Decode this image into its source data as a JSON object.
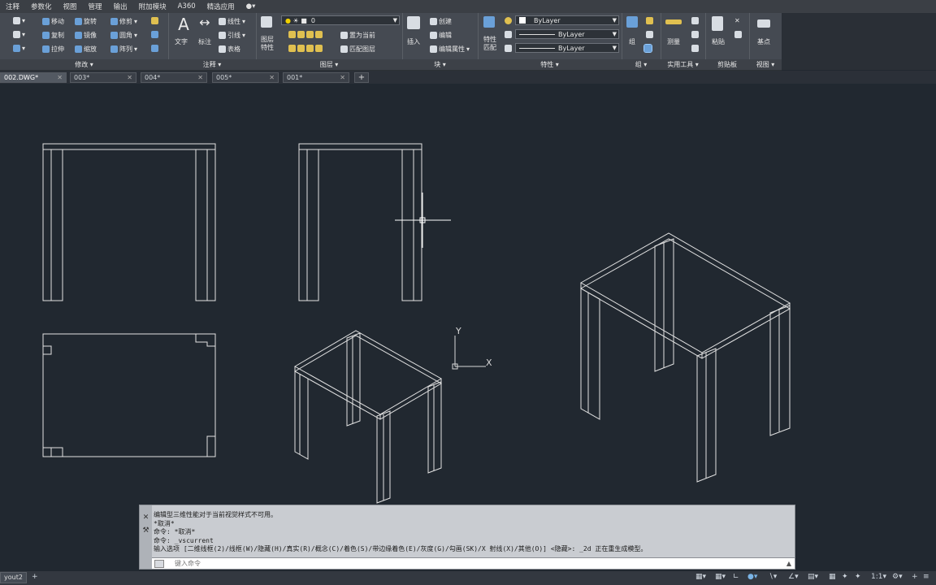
{
  "menubar": {
    "items": [
      "注释",
      "参数化",
      "视图",
      "管理",
      "输出",
      "附加模块",
      "A360",
      "精选应用"
    ]
  },
  "ribbon": {
    "modify": {
      "title": "修改",
      "items": [
        "移动",
        "旋转",
        "修剪",
        "复制",
        "镜像",
        "圆角",
        "拉伸",
        "缩放",
        "阵列"
      ]
    },
    "annotation": {
      "title": "注释",
      "text_label": "文字",
      "dim_label": "标注",
      "items": [
        "线性",
        "引线",
        "表格"
      ]
    },
    "layers": {
      "title": "图层",
      "props_label": "图层\n特性",
      "layer_value": "0",
      "items": [
        "置为当前",
        "匹配图层"
      ]
    },
    "block": {
      "title": "块",
      "insert_label": "插入",
      "items": [
        "创建",
        "编辑",
        "编辑属性"
      ]
    },
    "properties": {
      "title": "特性",
      "match_label": "特性\n匹配",
      "color_value": "ByLayer",
      "linetype_value": "ByLayer",
      "lineweight_value": "ByLayer"
    },
    "groups": {
      "title": "组",
      "label": "组"
    },
    "utilities": {
      "title": "实用工具",
      "label": "测量"
    },
    "clipboard": {
      "title": "剪贴板",
      "label": "粘贴"
    },
    "view": {
      "title": "视图",
      "label": "基点"
    }
  },
  "filetabs": [
    {
      "label": "002.DWG*",
      "active": true
    },
    {
      "label": "003*",
      "active": false
    },
    {
      "label": "004*",
      "active": false
    },
    {
      "label": "005*",
      "active": false
    },
    {
      "label": "001*",
      "active": false
    }
  ],
  "ucs": {
    "x_label": "X",
    "y_label": "Y"
  },
  "command": {
    "lines": [
      "编辑型三维性能对于当前视觉样式不可用。",
      "*取消*",
      "命令: *取消*",
      "命令: _vscurrent",
      "输入选项 [二维线框(2)/线框(W)/隐藏(H)/真实(R)/概念(C)/着色(S)/带边缘着色(E)/灰度(G)/勾画(SK)/X 射线(X)/其他(O)] <隐藏>: _2d 正在重生成模型。"
    ],
    "input_placeholder": "键入命令"
  },
  "statusbar": {
    "layout_tab": "yout2",
    "scale": "1:1"
  },
  "colors": {
    "canvas_bg": "#212830",
    "ribbon_bg": "#454a52",
    "drawing_line": "#e6e6e6"
  }
}
